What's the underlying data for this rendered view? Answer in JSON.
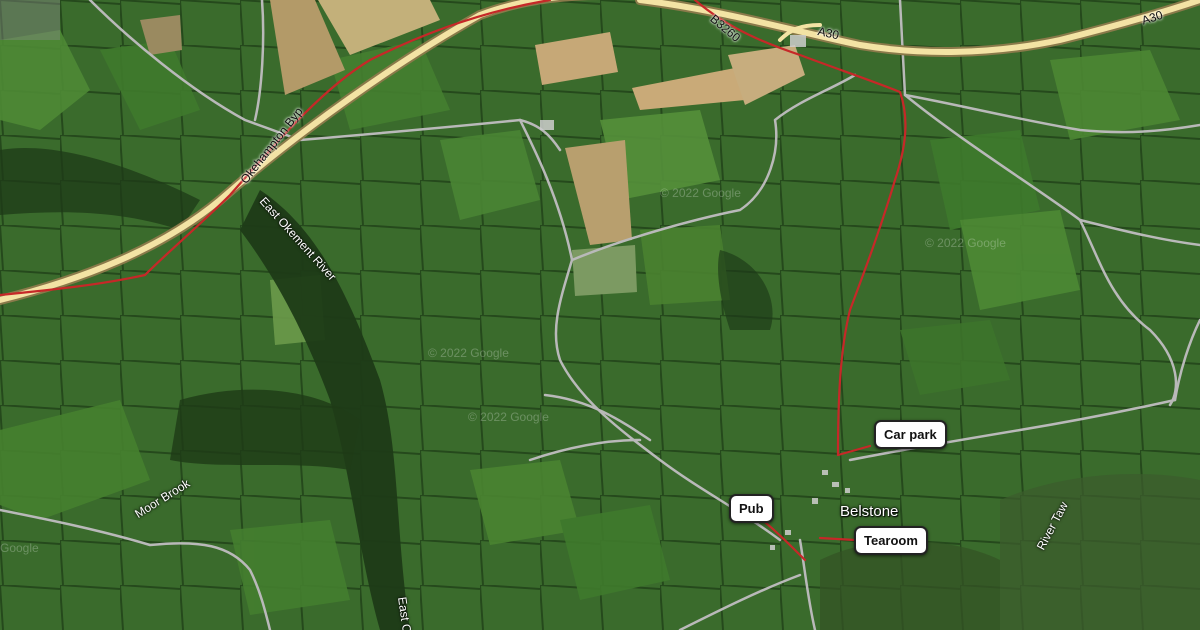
{
  "map": {
    "basemap": "satellite",
    "colors": {
      "route": "#c62828",
      "highway_fill": "#f3e3a4",
      "highway_edge": "#8a7a4a",
      "minor_road": "#b9b9b9",
      "field_dark": "#2f5a25",
      "field_mid": "#3f7330",
      "field_light": "#5a8a3c",
      "field_brown": "#b79f6a",
      "woodland": "#1f3d1a"
    },
    "callouts": {
      "car_park": "Car park",
      "pub": "Pub",
      "tearoom": "Tearoom"
    },
    "place_label": "Belstone",
    "road_labels": {
      "a30_left": "A30",
      "a30_right": "A30",
      "b3260": "B3260",
      "okehampton_byp": "Okehampton Byp"
    },
    "water_labels": {
      "east_okement_river": "East Okement River",
      "east_okement_bottom": "East Ok",
      "moor_brook": "Moor Brook",
      "river_taw": "River Taw"
    },
    "watermarks": [
      "© 2022 Google",
      "© 2022 Google",
      "© 2022 Google",
      "© 2022 Google",
      "Google"
    ]
  }
}
